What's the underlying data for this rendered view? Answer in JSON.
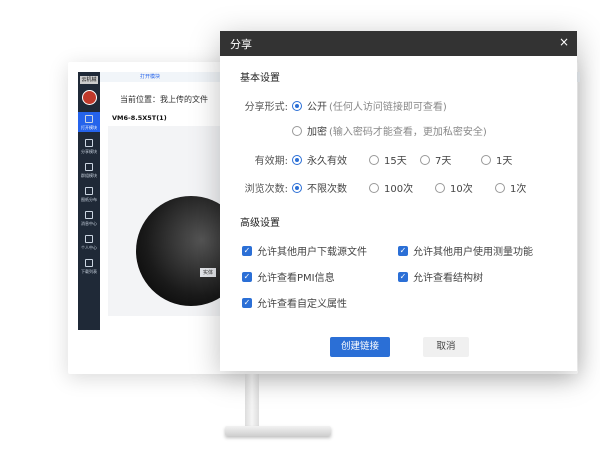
{
  "background_app": {
    "logo_text": "云机械",
    "tab_label": "打开模块",
    "breadcrumb": "当前位置：我上传的文件",
    "filename": "VM6-8.5X5T(1)",
    "sidebar_items": [
      "打开模块",
      "分享模块",
      "群组模块",
      "图纸分布",
      "消息中心",
      "个人中心",
      "下载列表"
    ],
    "model_label": "实体"
  },
  "dialog": {
    "title": "分享",
    "close_glyph": "×",
    "basic_section": "基本设置",
    "share_form": {
      "label": "分享形式:",
      "options": [
        {
          "label": "公开",
          "note": "(任何人访问链接即可查看)",
          "selected": true
        },
        {
          "label": "加密",
          "note": "(输入密码才能查看，更加私密安全)",
          "selected": false
        }
      ]
    },
    "validity": {
      "label": "有效期:",
      "options": [
        {
          "label": "永久有效",
          "selected": true
        },
        {
          "label": "15天",
          "selected": false
        },
        {
          "label": "7天",
          "selected": false
        },
        {
          "label": "1天",
          "selected": false
        }
      ]
    },
    "view_count": {
      "label": "浏览次数:",
      "options": [
        {
          "label": "不限次数",
          "selected": true
        },
        {
          "label": "100次",
          "selected": false
        },
        {
          "label": "10次",
          "selected": false
        },
        {
          "label": "1次",
          "selected": false
        }
      ]
    },
    "advanced_section": "高级设置",
    "permissions": [
      {
        "label": "允许其他用户下载源文件",
        "checked": true
      },
      {
        "label": "允许其他用户使用测量功能",
        "checked": true
      },
      {
        "label": "允许查看PMI信息",
        "checked": true
      },
      {
        "label": "允许查看结构树",
        "checked": true
      },
      {
        "label": "允许查看自定义属性",
        "checked": true
      }
    ],
    "create_button": "创建链接",
    "cancel_button": "取消"
  },
  "colors": {
    "accent": "#2b6fd6",
    "header": "#333333"
  }
}
